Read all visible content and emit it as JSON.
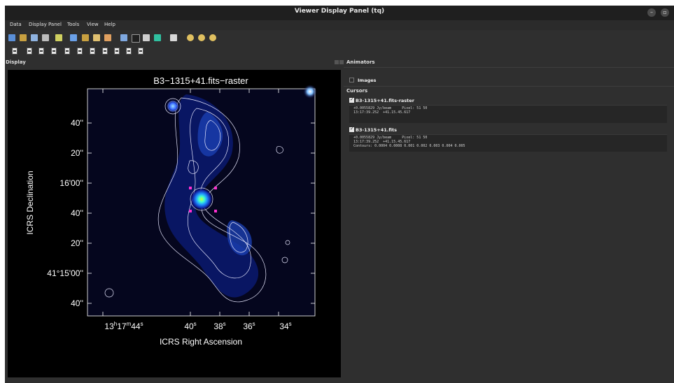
{
  "window": {
    "title": "Viewer Display Panel (tq)",
    "minimize_glyph": "–",
    "restore_glyph": "▫"
  },
  "menu": [
    "Data",
    "Display Panel",
    "Tools",
    "View",
    "Help"
  ],
  "toolbar1_icons": [
    "open-data-icon",
    "wrench-icon",
    "copy-panel-icon",
    "panel-options-icon",
    "close-panel-icon",
    "new-panel-icon",
    "adjust-icon",
    "save-icon",
    "print-icon",
    "region-icon",
    "shape-icon",
    "image-icon",
    "colorbar-icon",
    "erase-icon",
    "zoom-in-icon",
    "zoom-out-icon",
    "zoom-fit-icon"
  ],
  "toolbar2_icons": [
    "mouse-tool-1-icon",
    "mouse-tool-2-icon",
    "mouse-tool-3-icon",
    "mouse-tool-4-icon",
    "mouse-tool-5-icon",
    "mouse-tool-6-icon",
    "mouse-tool-7-icon",
    "mouse-tool-8-icon",
    "mouse-tool-9-icon",
    "mouse-tool-10-icon",
    "mouse-tool-11-icon"
  ],
  "display": {
    "label": "Display",
    "plot_title": "B3−1315+41.fits−raster",
    "xlabel": "ICRS Right Ascension",
    "ylabel": "ICRS Declination",
    "x_ticks": [
      {
        "h": "13",
        "hs": "h",
        "m": "17",
        "ms": "m",
        "s": "44",
        "ss": "s"
      },
      {
        "s": "40",
        "ss": "s"
      },
      {
        "s": "38",
        "ss": "s"
      },
      {
        "s": "36",
        "ss": "s"
      },
      {
        "s": "34",
        "ss": "s"
      }
    ],
    "y_ticks": [
      {
        "text": "40''"
      },
      {
        "text": "20''"
      },
      {
        "text": "16'00''"
      },
      {
        "text": "40''"
      },
      {
        "text": "20''"
      },
      {
        "text": "41°15'00''"
      },
      {
        "text": "40''"
      }
    ]
  },
  "animators": {
    "label": "Animators",
    "images_label": "Images"
  },
  "cursors": {
    "label": "Cursors",
    "items": [
      {
        "name": "B3-1315+41.fits-raster",
        "checked": true,
        "lines": [
          "+0.0055829 Jy/beam     Pixel: 51 50",
          "13:17:39.252  +41.15.45.617"
        ]
      },
      {
        "name": "B3-1315+41.fits",
        "checked": true,
        "lines": [
          "+0.0055829 Jy/beam     Pixel: 51 50",
          "13:17:39.252  +41.15.45.617",
          "Contours: 0.0004 0.0008 0.001 0.002 0.003 0.004 0.005"
        ]
      }
    ]
  }
}
